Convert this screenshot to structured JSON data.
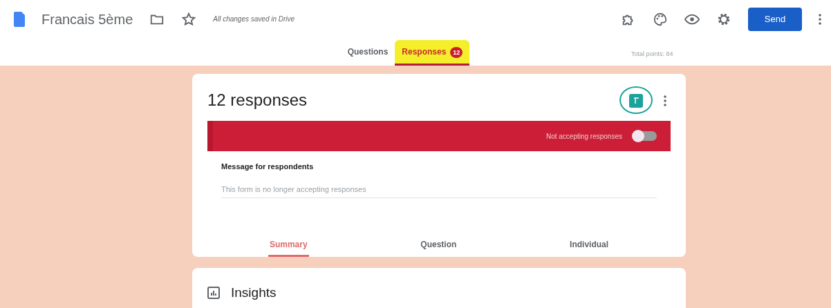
{
  "header": {
    "title": "Francais 5ème",
    "save_status": "All changes saved in Drive",
    "send_label": "Send"
  },
  "tabs": [
    {
      "label": "Questions",
      "selected": false
    },
    {
      "label": "Responses",
      "selected": true,
      "badge": "12",
      "highlighted": true
    }
  ],
  "total_points": "Total points: 84",
  "responses_card": {
    "title": "12 responses",
    "sheets_circled": true,
    "accepting": {
      "label": "Not accepting responses",
      "on": false
    },
    "message_label": "Message for respondents",
    "message": "This form is no longer accepting responses"
  },
  "view_tabs": [
    {
      "label": "Summary",
      "selected": true
    },
    {
      "label": "Question",
      "selected": false
    },
    {
      "label": "Individual",
      "selected": false
    }
  ],
  "insights": {
    "title": "Insights"
  }
}
